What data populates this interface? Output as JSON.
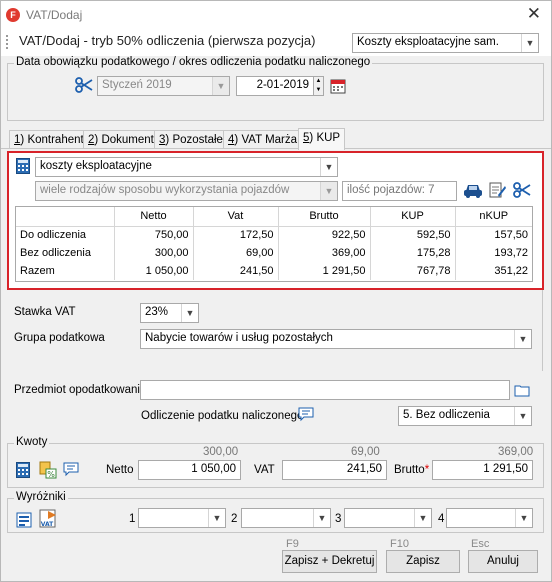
{
  "window": {
    "title": "VAT/Dodaj",
    "close_glyph": "✕",
    "app_badge": "F"
  },
  "header": {
    "title": "VAT/Dodaj - tryb 50% odliczenia (pierwsza pozycja)",
    "category_select": "Koszty eksploatacyjne sam."
  },
  "period": {
    "group_label": "Data obowiązku podatkowego / okres odliczenia podatku naliczonego",
    "month": "Styczeń 2019",
    "date": "2-01-2019"
  },
  "tabs": [
    {
      "key": "1",
      "label": "Kontrahent"
    },
    {
      "key": "2",
      "label": "Dokument"
    },
    {
      "key": "3",
      "label": "Pozostałe"
    },
    {
      "key": "4",
      "label": "VAT Marża"
    },
    {
      "key": "5",
      "label": "KUP"
    }
  ],
  "kup": {
    "cost_type": "koszty eksploatacyjne",
    "usage_mode": "wiele rodzajów sposobu wykorzystania pojazdów",
    "vehicle_count": "ilość pojazdów: 7",
    "columns": [
      "",
      "Netto",
      "Vat",
      "Brutto",
      "KUP",
      "nKUP"
    ],
    "rows": [
      [
        "Do odliczenia",
        "750,00",
        "172,50",
        "922,50",
        "592,50",
        "157,50"
      ],
      [
        "Bez odliczenia",
        "300,00",
        "69,00",
        "369,00",
        "175,28",
        "193,72"
      ],
      [
        "Razem",
        "1 050,00",
        "241,50",
        "1 291,50",
        "767,78",
        "351,22"
      ]
    ]
  },
  "form": {
    "stawka_label": "Stawka VAT",
    "stawka_value": "23%",
    "grupa_label": "Grupa podatkowa",
    "grupa_value": "Nabycie towarów i usług pozostałych",
    "przedmiot_label": "Przedmiot opodatkowania",
    "przedmiot_value": "",
    "odliczenie_label": "Odliczenie podatku naliczonego",
    "odliczenie_value": "5. Bez odliczenia"
  },
  "kwoty": {
    "group_label": "Kwoty",
    "netto_hint": "300,00",
    "vat_hint": "69,00",
    "brutto_hint": "369,00",
    "netto_label": "Netto",
    "netto_value": "1 050,00",
    "vat_label": "VAT",
    "vat_value": "241,50",
    "brutto_label": "Brutto",
    "brutto_required": "*",
    "brutto_value": "1 291,50"
  },
  "wyrozniki": {
    "group_label": "Wyróżniki",
    "slots": [
      "1",
      "2",
      "3",
      "4"
    ]
  },
  "footer": {
    "save_post_key": "F9",
    "save_post_label": "Zapisz + Dekretuj",
    "save_key": "F10",
    "save_label": "Zapisz",
    "cancel_key": "Esc",
    "cancel_label": "Anuluj"
  }
}
